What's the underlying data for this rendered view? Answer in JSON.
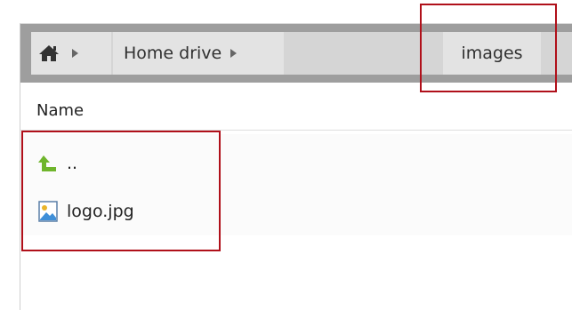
{
  "breadcrumb": {
    "home_icon": "home-icon",
    "items": [
      {
        "label": "Home drive"
      },
      {
        "label": "images"
      }
    ]
  },
  "file_list": {
    "column_header": "Name",
    "rows": [
      {
        "icon": "parent-folder-arrow-icon",
        "name": ".."
      },
      {
        "icon": "image-file-icon",
        "name": "logo.jpg"
      }
    ]
  },
  "colors": {
    "annotation": "#b0101a",
    "up_arrow": "#6fb52c",
    "address_bar": "#9e9e9e"
  }
}
